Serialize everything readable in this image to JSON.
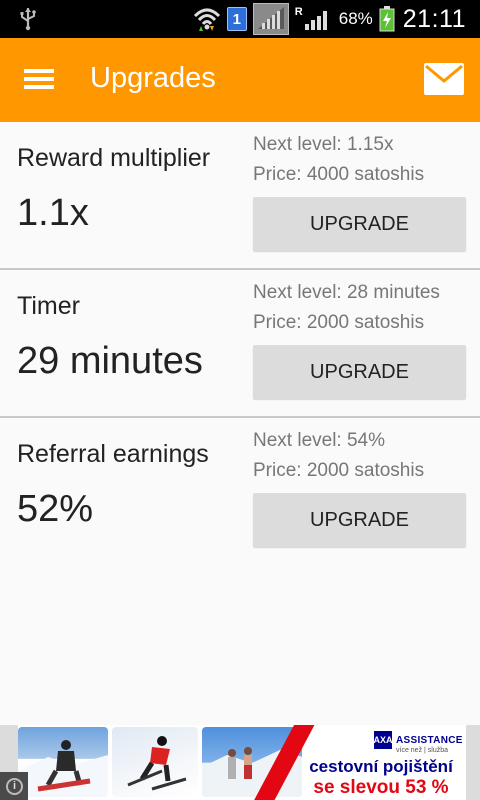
{
  "status_bar": {
    "sim_badge": "1",
    "roaming_indicator": "R",
    "battery_percent": "68%",
    "time": "21:11",
    "icons": [
      "usb-icon",
      "wifi-icon",
      "sim-badge",
      "signal-icon",
      "signal-icon",
      "battery-charging-icon"
    ]
  },
  "app_bar": {
    "title": "Upgrades",
    "menu_icon": "hamburger-menu-icon",
    "mail_icon": "mail-icon",
    "background_color": "#ff9800"
  },
  "upgrades": [
    {
      "name": "Reward multiplier",
      "current_value": "1.1x",
      "next_level": "Next level: 1.15x",
      "price": "Price: 4000 satoshis",
      "button_label": "UPGRADE"
    },
    {
      "name": "Timer",
      "current_value": "29 minutes",
      "next_level": "Next level: 28 minutes",
      "price": "Price: 2000 satoshis",
      "button_label": "UPGRADE"
    },
    {
      "name": "Referral earnings",
      "current_value": "52%",
      "next_level": "Next level: 54%",
      "price": "Price: 2000 satoshis",
      "button_label": "UPGRADE"
    }
  ],
  "ad": {
    "brand": "AXA",
    "brand_label": "ASSISTANCE",
    "tagline": "více než | služba",
    "headline_line1": "cestovní pojištění",
    "headline_line2": "se slevou 53 %",
    "info_icon": "info-icon",
    "accent_color": "#e30613",
    "brand_color": "#00008f"
  }
}
